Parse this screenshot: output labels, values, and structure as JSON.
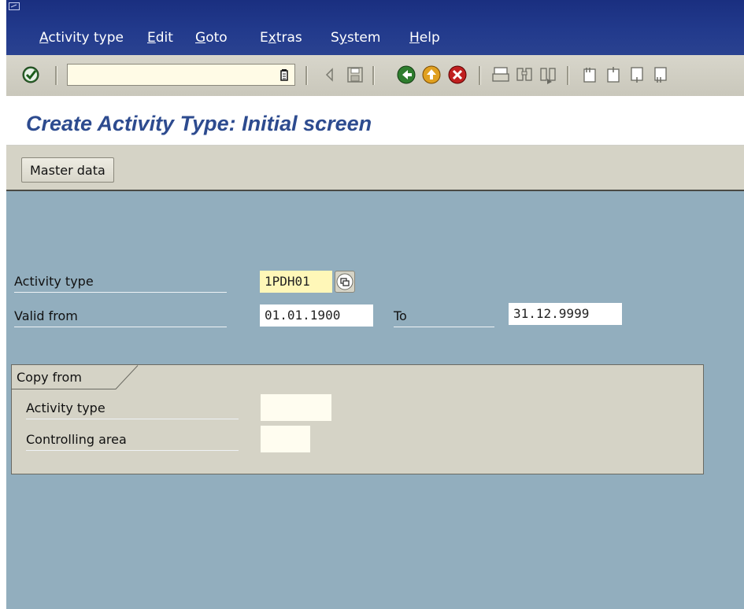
{
  "menubar": {
    "items": [
      {
        "label": "Activity type",
        "underline": "A"
      },
      {
        "label": "Edit",
        "underline": "E"
      },
      {
        "label": "Goto",
        "underline": "G"
      },
      {
        "label": "Extras",
        "underline": "x"
      },
      {
        "label": "System",
        "underline": "y"
      },
      {
        "label": "Help",
        "underline": "H"
      }
    ]
  },
  "toolbar": {
    "command_value": "",
    "icons": [
      "enter-icon",
      "command-field-icon",
      "back-arrow-icon",
      "save-icon",
      "back-icon",
      "exit-icon",
      "cancel-icon",
      "print-icon",
      "find-icon",
      "find-next-icon",
      "first-page-icon",
      "previous-page-icon",
      "next-page-icon",
      "last-page-icon"
    ]
  },
  "title": "Create Activity Type: Initial screen",
  "app_toolbar": {
    "master_data_label": "Master data"
  },
  "form": {
    "activity_type_label": "Activity type",
    "activity_type_value": "1PDH01",
    "valid_from_label": "Valid from",
    "valid_from_value": "01.01.1900",
    "to_label": "To",
    "to_value": "31.12.9999"
  },
  "copy_from": {
    "tab_label": "Copy from",
    "activity_type_label": "Activity type",
    "activity_type_value": "",
    "controlling_area_label": "Controlling area",
    "controlling_area_value": ""
  },
  "colors": {
    "menubar": "#223a8c",
    "title": "#2d4b8f",
    "background": "#92aebe",
    "required_field": "#fff7b8"
  }
}
